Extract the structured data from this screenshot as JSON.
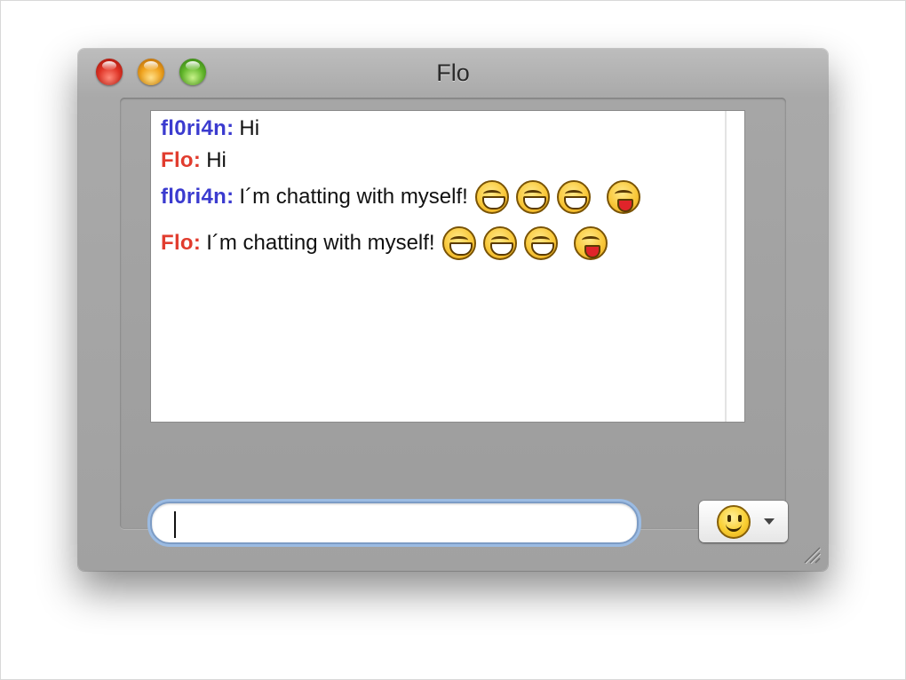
{
  "window": {
    "title": "Flo",
    "controls": {
      "close": "close-button",
      "minimize": "minimize-button",
      "zoom": "zoom-button"
    }
  },
  "colors": {
    "sender_self": "#3b3bcf",
    "sender_other": "#e13c2e",
    "input_focus_ring": "#9bbbe2"
  },
  "chat": {
    "messages": [
      {
        "sender": "fl0ri4n:",
        "text": "Hi",
        "emoticons": []
      },
      {
        "sender": "Flo:",
        "text": "Hi",
        "emoticons": []
      },
      {
        "sender": "fl0ri4n:",
        "text": "I´m chatting with myself!",
        "emoticons": [
          "grin-icon",
          "grin-icon",
          "grin-icon",
          "tongue-icon"
        ]
      },
      {
        "sender": "Flo:",
        "text": "I´m chatting with myself!",
        "emoticons": [
          "grin-icon",
          "grin-icon",
          "grin-icon",
          "tongue-icon"
        ]
      }
    ]
  },
  "composer": {
    "value": "",
    "emoticon_button_icon": "smiley-icon",
    "dropdown_icon": "chevron-down-icon"
  }
}
